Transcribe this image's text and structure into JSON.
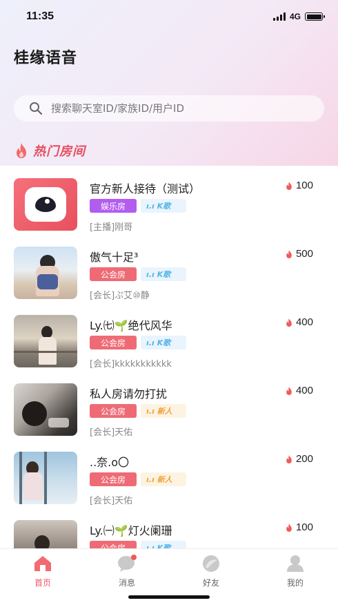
{
  "status": {
    "time": "11:35",
    "network": "4G"
  },
  "app_title": "桂缘语音",
  "search": {
    "placeholder": "搜索聊天室ID/家族ID/用户ID"
  },
  "section_title": "热门房间",
  "rooms": [
    {
      "name": "官方新人接待（测试）",
      "type": "娱乐房",
      "type_color": "#b25cf0",
      "level": "K歌",
      "level_color": "#52b6e8",
      "level_bg": "#eaf4fd",
      "host": "[主播]刚哥",
      "heat": "100",
      "thumb": "eye-logo"
    },
    {
      "name": "傲气十足³",
      "type": "公会房",
      "type_color": "#ee6b76",
      "level": "K歌",
      "level_color": "#52b6e8",
      "level_bg": "#eaf4fd",
      "host": "[会长]ぷ艾⑩静",
      "heat": "500",
      "thumb": "photo-beach"
    },
    {
      "name": "Ly.㈦🌱绝代风华",
      "type": "公会房",
      "type_color": "#ee6b76",
      "level": "K歌",
      "level_color": "#52b6e8",
      "level_bg": "#eaf4fd",
      "host": "[会长]kkkkkkkkkkk",
      "heat": "400",
      "thumb": "photo-sunset"
    },
    {
      "name": "私人房请勿打扰",
      "type": "公会房",
      "type_color": "#ee6b76",
      "level": "新人",
      "level_color": "#f2a33a",
      "level_bg": "#fdf3e2",
      "host": "[会长]天佑",
      "heat": "400",
      "thumb": "photo-car"
    },
    {
      "name": "..奈.o〇",
      "type": "公会房",
      "type_color": "#ee6b76",
      "level": "新人",
      "level_color": "#f2a33a",
      "level_bg": "#fdf3e2",
      "host": "[会长]天佑",
      "heat": "200",
      "thumb": "photo-window"
    },
    {
      "name": "Ly.㈠🌱灯火阑珊",
      "type": "公会房",
      "type_color": "#ee6b76",
      "level": "K歌",
      "level_color": "#52b6e8",
      "level_bg": "#eaf4fd",
      "host": "",
      "heat": "100",
      "thumb": "photo-dark"
    }
  ],
  "tabs": [
    {
      "label": "首页",
      "icon": "home-icon",
      "active": true
    },
    {
      "label": "消息",
      "icon": "message-icon",
      "active": false
    },
    {
      "label": "好友",
      "icon": "friends-icon",
      "active": false
    },
    {
      "label": "我的",
      "icon": "profile-icon",
      "active": false
    }
  ],
  "colors": {
    "accent": "#ee5566",
    "flame": "#f05a5a"
  }
}
